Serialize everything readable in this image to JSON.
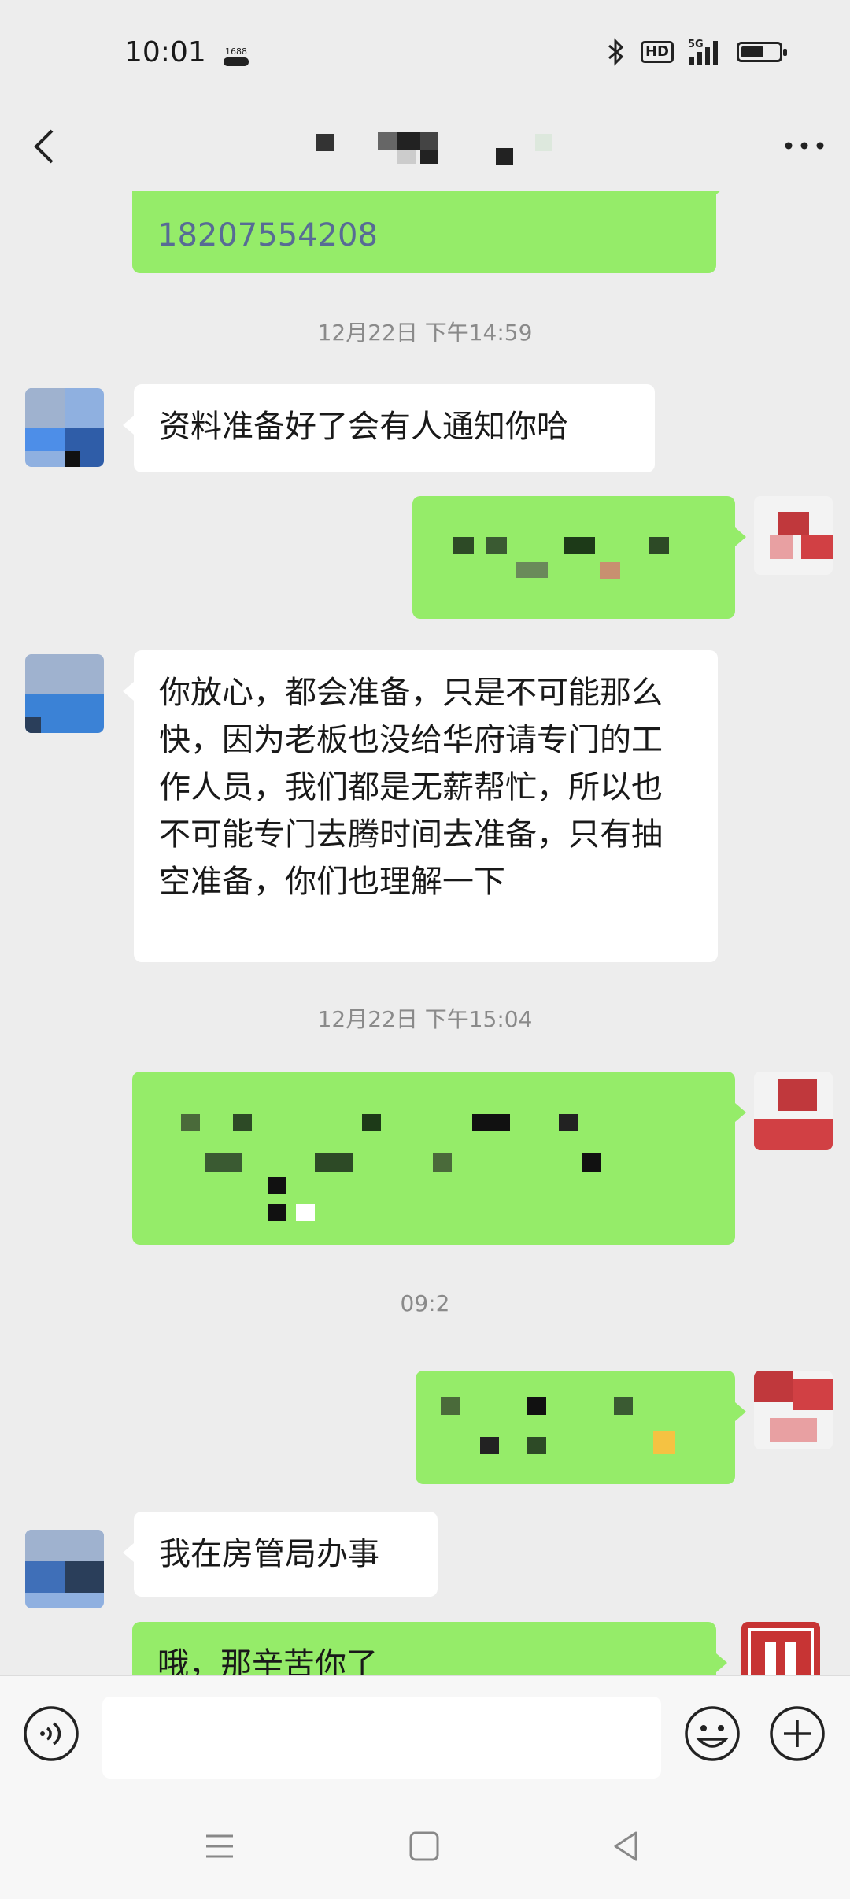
{
  "status_bar": {
    "time": "10:01",
    "app_badge": "1688",
    "hd_label": "HD",
    "network": "5G",
    "battery_level": 0.6
  },
  "header": {
    "title": ""
  },
  "messages": [
    {
      "type": "sent_partial",
      "phone": "18207554208"
    },
    {
      "type": "timestamp",
      "text": "12月22日 下午14:59"
    },
    {
      "type": "received",
      "text": "资料准备好了会有人通知你哈"
    },
    {
      "type": "sent",
      "text": ""
    },
    {
      "type": "received",
      "text": "你放心，都会准备，只是不可能那么快，因为老板也没给华府请专门的工作人员，我们都是无薪帮忙，所以也不可能专门去腾时间去准备，只有抽空准备，你们也理解一下"
    },
    {
      "type": "timestamp",
      "text": "12月22日 下午15:04"
    },
    {
      "type": "sent",
      "text": ""
    },
    {
      "type": "timestamp",
      "text": "09:2"
    },
    {
      "type": "sent",
      "text": ""
    },
    {
      "type": "received",
      "text": "我在房管局办事"
    },
    {
      "type": "sent",
      "text": "哦，那辛苦你了"
    }
  ],
  "input_bar": {
    "placeholder": ""
  },
  "colors": {
    "sent_bubble": "#95ec69",
    "received_bubble": "#ffffff",
    "background": "#ededed",
    "link": "#576b95"
  }
}
